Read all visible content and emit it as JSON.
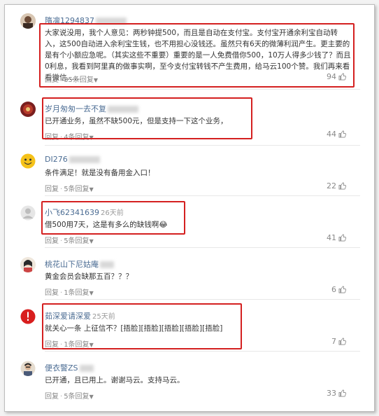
{
  "comments": [
    {
      "username": "隋凛1294837",
      "timestamp": "",
      "text": "大家说没用，我个人意见：两秒钟提500，而且是自动在支付宝。支付宝开通余利宝自动转入，这500自动进入余利宝生钱，也不用担心没钱还。虽然只有6天的微薄利润产生。更主要的是有个小额应急呢。（其实这些不重要）重要的是一人免费借你500，10万人得多少钱了？而且0利息，我看到阿里真的做事实啊，至今支付宝转钱不产生费用，给马云100个赞。我们再来看看微信……",
      "reply_label": "回复",
      "replies_label": "35条回复",
      "likes": "94"
    },
    {
      "username": "岁月匆匆一去不复",
      "timestamp": "",
      "text": "已开通业务，虽然不缺500元，但是支持一下这个业务，",
      "reply_label": "回复",
      "replies_label": "4条回复",
      "likes": "44"
    },
    {
      "username": "DI276",
      "timestamp": "",
      "text": "条件满足！就是没有备用金入口！",
      "reply_label": "回复",
      "replies_label": "5条回复",
      "likes": "22"
    },
    {
      "username": "小飞62341639",
      "timestamp": "26天前",
      "text": "借500用7天，这是有多么的缺钱啊😂",
      "reply_label": "回复",
      "replies_label": "5条回复",
      "likes": "41"
    },
    {
      "username": "桃花山下尼姑庵",
      "timestamp": "",
      "text": "黄金会员会缺那五百？？？",
      "reply_label": "回复",
      "replies_label": "1条回复",
      "likes": "6"
    },
    {
      "username": "茹深爱请深爱",
      "timestamp": "25天前",
      "text": "就关心一条 上征信不？[捂脸][捂脸][捂脸][捂脸][捂脸]",
      "reply_label": "回复",
      "replies_label": "1条回复",
      "likes": "7"
    },
    {
      "username": "便衣警ZS",
      "timestamp": "",
      "text": "已开通，且已用上。谢谢马云。支持马云。",
      "reply_label": "回复",
      "replies_label": "5条回复",
      "likes": "33"
    }
  ],
  "icons": {
    "like": "thumb-up-icon",
    "expand": "triangle-down-icon"
  },
  "colors": {
    "username": "#4b6c93",
    "highlight": "#d42020",
    "meta": "#888888"
  }
}
